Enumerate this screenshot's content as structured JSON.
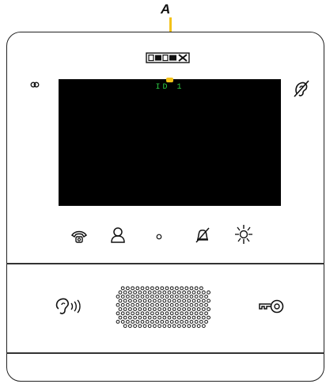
{
  "annotation": {
    "letter": "A"
  },
  "brand": {
    "name": "ELVOX"
  },
  "screen": {
    "text": "ID 1"
  },
  "icons": {
    "top_left": "led-indicator-icon",
    "top_right": "hearing-aid-icon",
    "row1": [
      "handset-icon",
      "person-icon",
      "center-dot-icon",
      "mute-bell-icon",
      "light-icon"
    ],
    "bottom": [
      "audio-call-icon",
      "speaker-grille",
      "door-key-icon"
    ]
  },
  "colors": {
    "screen_text": "#2dcc44",
    "annotation": "#f3c21a"
  }
}
